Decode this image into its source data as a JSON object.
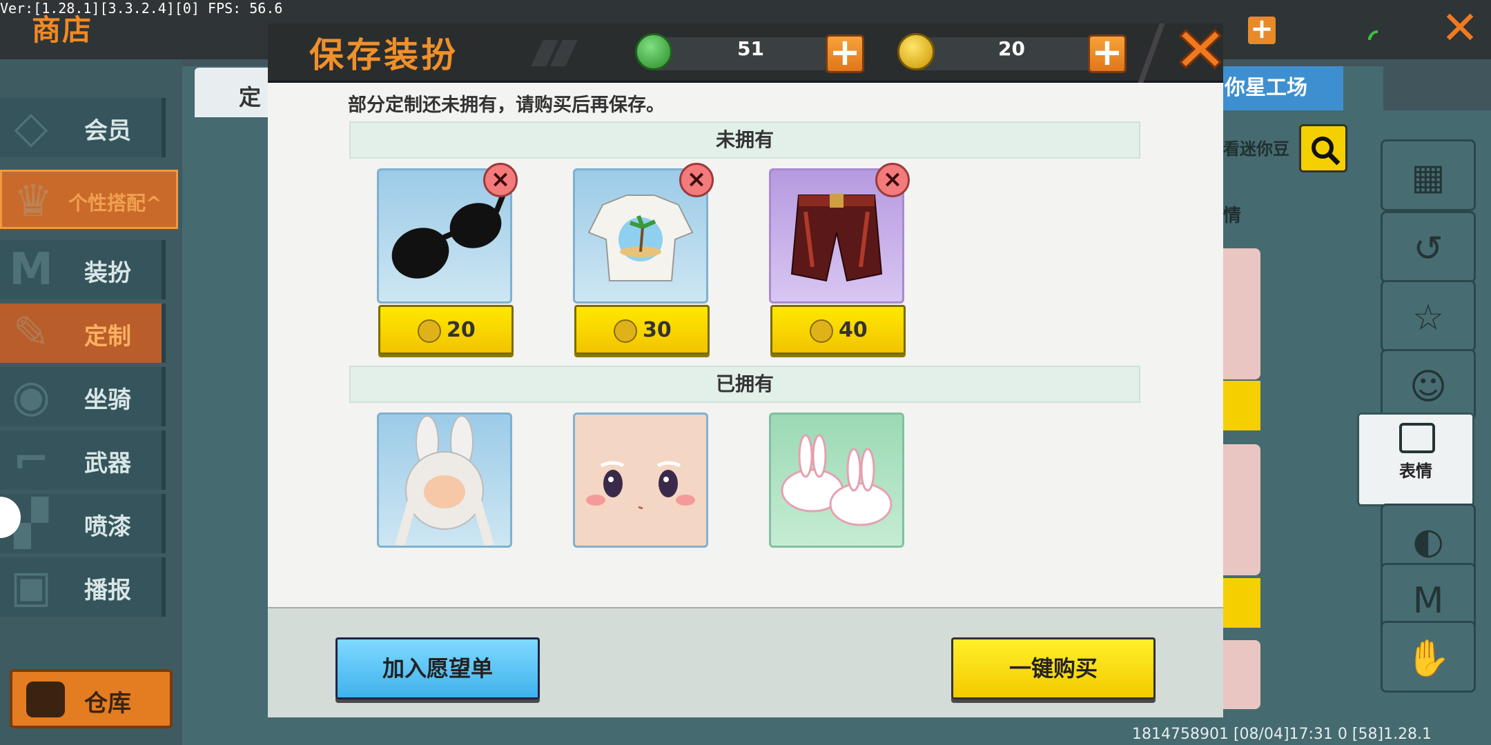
{
  "debug": {
    "text": "Ver:[1.28.1][3.3.2.4][0] FPS: 56.6"
  },
  "background": {
    "shop_title": "商店",
    "tab_label": "定",
    "workshop_label": "你星工场",
    "search_label": "看迷你豆",
    "side_label_2": "情",
    "face_label": "表情",
    "footer": "1814758901   [08/04]17:31 0   [58]1.28.1"
  },
  "sidebar": {
    "items": [
      {
        "label": "会员",
        "icon": "member-icon"
      },
      {
        "label": "个性搭配^",
        "icon": "trophy-icon"
      },
      {
        "label": "装扮",
        "icon": "shirt-icon"
      },
      {
        "label": "定制",
        "icon": "pencil-icon"
      },
      {
        "label": "坐骑",
        "icon": "mount-icon"
      },
      {
        "label": "武器",
        "icon": "gun-icon"
      },
      {
        "label": "喷漆",
        "icon": "spray-icon"
      },
      {
        "label": "播报",
        "icon": "broadcast-icon"
      }
    ],
    "warehouse": "仓库"
  },
  "modal": {
    "title": "保存装扮",
    "currency": [
      {
        "name": "mini-bean",
        "value": "51",
        "color": "#3fa83f"
      },
      {
        "name": "mini-coin",
        "value": "20",
        "color": "#e0b21a"
      }
    ],
    "notice": "部分定制还未拥有，请购买后再保存。",
    "unowned_header": "未拥有",
    "owned_header": "已拥有",
    "unowned_items": [
      {
        "name": "sunglasses",
        "price": "20"
      },
      {
        "name": "tropical-tshirt",
        "price": "30"
      },
      {
        "name": "red-shorts",
        "price": "40"
      }
    ],
    "owned_items": [
      {
        "name": "bunny-hair"
      },
      {
        "name": "face"
      },
      {
        "name": "bunny-slippers"
      }
    ],
    "wishlist_button": "加入愿望单",
    "buy_button": "一键购买"
  },
  "colors": {
    "accent_orange": "#f0902a",
    "buy_yellow": "#f5d000",
    "wish_blue": "#3fb2ec"
  }
}
